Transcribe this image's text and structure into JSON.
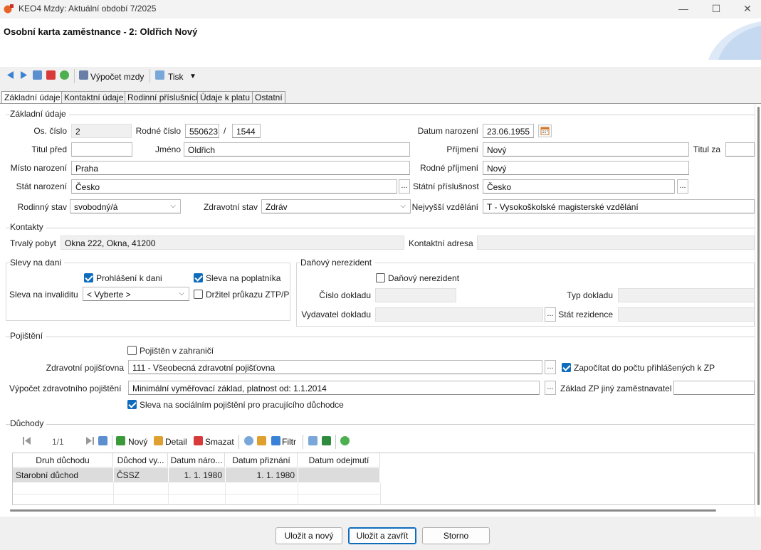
{
  "window": {
    "title": "KEO4 Mzdy: Aktuální období 7/2025",
    "min": "—",
    "max": "☐",
    "close": "✕"
  },
  "header": {
    "title": "Osobní karta zaměstnance - 2: Oldřich Nový"
  },
  "toolbar": {
    "vypocet": "Výpočet mzdy",
    "tisk": "Tisk",
    "dropdown": "▼"
  },
  "tabs": [
    {
      "label": "Základní údaje"
    },
    {
      "label": "Kontaktní údaje"
    },
    {
      "label": "Rodinní příslušníci"
    },
    {
      "label": "Údaje k platu"
    },
    {
      "label": "Ostatní"
    }
  ],
  "zakladni": {
    "legend": "Základní údaje",
    "os_cislo_label": "Os. číslo",
    "os_cislo": "2",
    "rodne_cislo_label": "Rodné číslo",
    "rc1": "550623",
    "rc_sep": "/",
    "rc2": "1544",
    "datum_narozeni_label": "Datum narození",
    "datum_narozeni": "23.06.1955",
    "titul_pred_label": "Titul před",
    "titul_pred": "",
    "jmeno_label": "Jméno",
    "jmeno": "Oldřich",
    "prijmeni_label": "Příjmení",
    "prijmeni": "Nový",
    "titul_za_label": "Titul za",
    "titul_za": "",
    "misto_label": "Místo narození",
    "misto": "Praha",
    "rodne_prijmeni_label": "Rodné příjmení",
    "rodne_prijmeni": "Nový",
    "stat_narozeni_label": "Stát narození",
    "stat_narozeni": "Česko",
    "statni_prislusnost_label": "Státní příslušnost",
    "statni_prislusnost": "Česko",
    "rodinny_stav_label": "Rodinný stav",
    "rodinny_stav": "svobodný/á",
    "zdravotni_stav_label": "Zdravotní stav",
    "zdravotni_stav": "Zdráv",
    "vzdelani_label": "Nejvyšší vzdělání",
    "vzdelani": "T - Vysokoškolské magisterské vzdělání",
    "dots": "..."
  },
  "kontakty": {
    "legend": "Kontakty",
    "trvaly_label": "Trvalý pobyt",
    "trvaly": "Okna 222, Okna, 41200",
    "kontaktni_label": "Kontaktní adresa",
    "kontaktni": ""
  },
  "slevy": {
    "legend": "Slevy na dani",
    "prohlaseni": "Prohlášení k dani",
    "poplatnik": "Sleva na poplatníka",
    "invalidita_label": "Sleva na invaliditu",
    "invalidita": "< Vyberte >",
    "ztp": "Držitel průkazu ZTP/P"
  },
  "nerezident": {
    "legend": "Daňový nerezident",
    "check": "Daňový nerezident",
    "cislo_label": "Číslo dokladu",
    "typ_label": "Typ dokladu",
    "vydavatel_label": "Vydavatel dokladu",
    "stat_label": "Stát rezidence"
  },
  "pojisteni": {
    "legend": "Pojištění",
    "zahranici": "Pojištěn v zahraničí",
    "zp_label": "Zdravotní pojišťovna",
    "zp": "111 - Všeobecná zdravotní pojišťovna",
    "zapocitat": "Započítat do počtu přihlášených k ZP",
    "vypocet_label": "Výpočet zdravotního pojištění",
    "vypocet": "Minimální vyměřovací základ, platnost od: 1.1.2014",
    "zaklad_label": "Základ ZP jiný zaměstnavatel",
    "sleva_soc": "Sleva na sociálním pojištění pro pracujícího důchodce"
  },
  "duchody": {
    "legend": "Důchody",
    "pager": "1/1",
    "novy": "Nový",
    "detail": "Detail",
    "smazat": "Smazat",
    "filtr": "Filtr",
    "columns": [
      "Druh důchodu",
      "Důchod vy...",
      "Datum náro...",
      "Datum přiznání",
      "Datum odejmutí"
    ],
    "rows": [
      [
        "Starobní důchod",
        "ČSSZ",
        "1. 1. 1980",
        "1. 1. 1980",
        ""
      ]
    ]
  },
  "footer": {
    "ulozit_novy": "Uložit a nový",
    "ulozit_zavrit": "Uložit a zavřít",
    "storno": "Storno"
  }
}
